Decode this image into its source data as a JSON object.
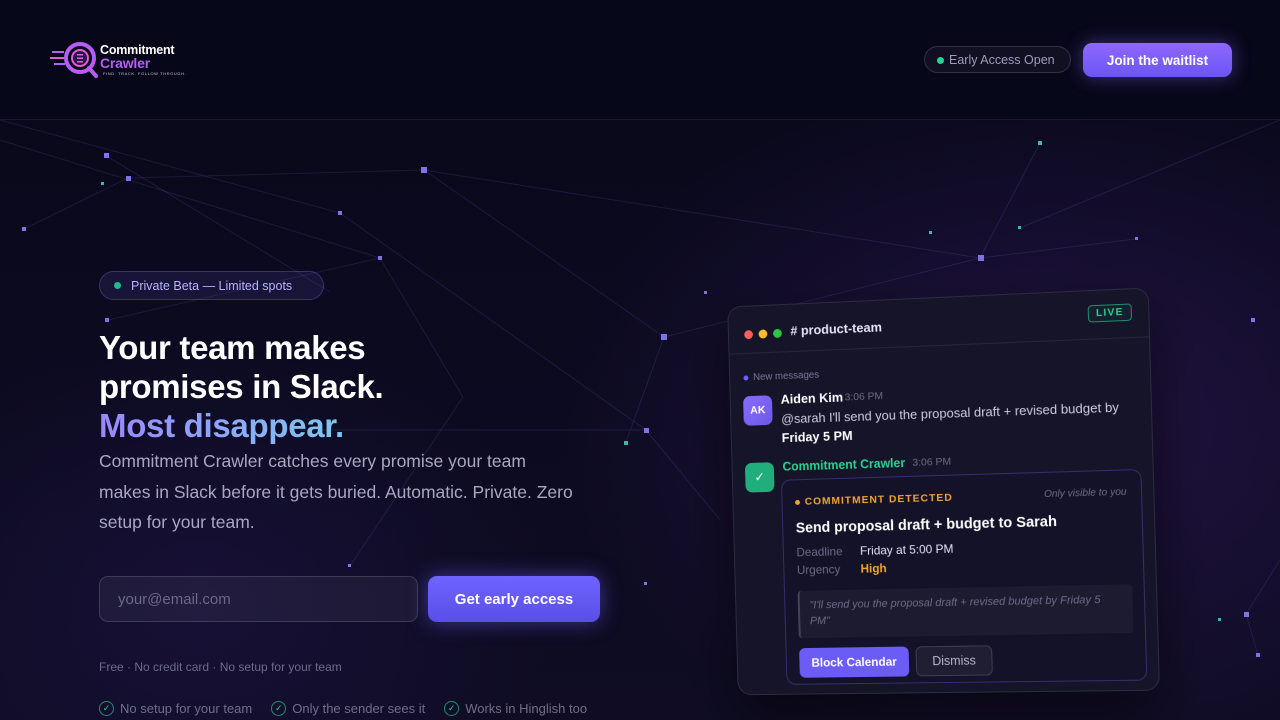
{
  "brand": {
    "name_line1": "Commitment",
    "name_line2": "Crawler",
    "tagline": "FIND. TRACK. FOLLOW THROUGH."
  },
  "nav": {
    "status_pill": "Early Access Open",
    "cta_label": "Join the waitlist"
  },
  "hero": {
    "beta_pill": "Private Beta — Limited spots",
    "headline_line1": "Your team makes",
    "headline_line2": "promises in Slack.",
    "headline_accent": "Most disappear.",
    "subtext": "Commitment Crawler catches every promise your team makes in Slack before it gets buried. Automatic. Private. Zero setup for your team.",
    "email_placeholder": "your@email.com",
    "cta_label": "Get early access",
    "fine_print": "Free · No credit card · No setup for your team",
    "checks": [
      "No setup for your team",
      "Only the sender sees it",
      "Works in Hinglish too"
    ]
  },
  "slack_card": {
    "channel": "# product-team",
    "live_badge": "LIVE",
    "new_messages": "New messages",
    "message": {
      "avatar_initials": "AK",
      "author": "Aiden Kim",
      "time": "3:06 PM",
      "text": "@sarah I'll send you the proposal draft + revised budget by ",
      "deadline_bold": "Friday 5 PM"
    },
    "bot": {
      "name": "Commitment Crawler",
      "time": "3:06 PM",
      "detected_label": "COMMITMENT DETECTED",
      "visibility": "Only visible to you",
      "title": "Send proposal draft + budget to Sarah",
      "deadline_key": "Deadline",
      "deadline_value": "Friday at 5:00 PM",
      "urgency_key": "Urgency",
      "urgency_value": "High",
      "quote": "\"I'll send you the proposal draft + revised budget by Friday 5 PM\"",
      "primary_action": "Block Calendar",
      "secondary_action": "Dismiss"
    }
  },
  "colors": {
    "accent": "#6a5cf5",
    "success": "#2bd18f",
    "warning": "#f0a531",
    "background": "#0a0919"
  }
}
